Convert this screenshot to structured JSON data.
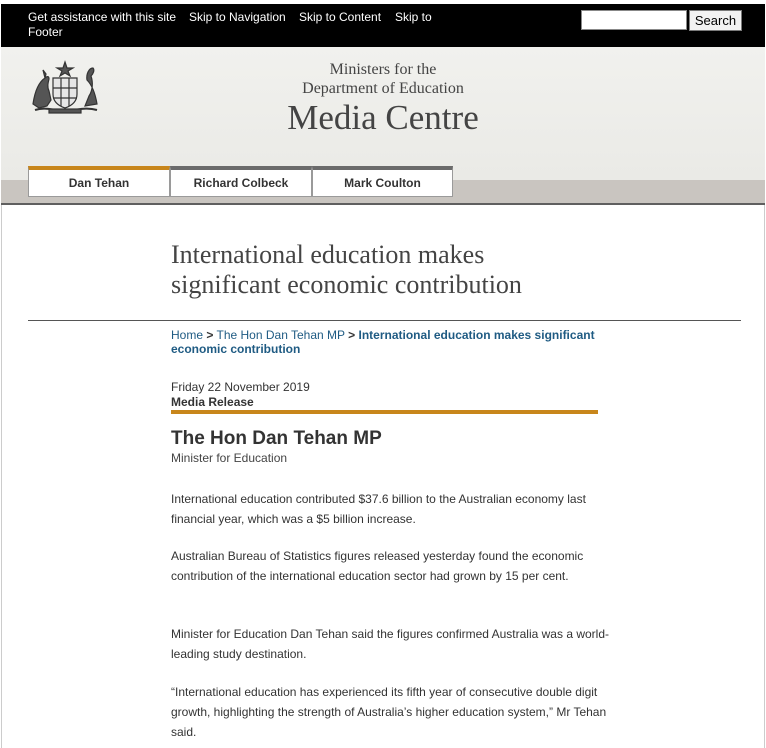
{
  "topbar": {
    "skip_assistance": "Get assistance with this site",
    "skip_navigation": "Skip to Navigation",
    "skip_content": "Skip to Content",
    "skip_footer_line1": "Skip to",
    "skip_footer_line2": "Footer",
    "search_placeholder": "",
    "search_button": "Search"
  },
  "header": {
    "ministers_line1": "Ministers for the",
    "ministers_line2": "Department of Education",
    "site_title": "Media Centre",
    "crest_icon": "coat-of-arms-icon"
  },
  "tabs": [
    {
      "label": "Dan Tehan",
      "active": true
    },
    {
      "label": "Richard Colbeck",
      "active": false
    },
    {
      "label": "Mark Coulton",
      "active": false
    }
  ],
  "article": {
    "title_line1": "International education makes",
    "title_line2": "significant economic contribution",
    "breadcrumb": {
      "home": "Home",
      "sep": ">",
      "minister": "The Hon Dan Tehan MP",
      "current": "International education makes significant economic contribution"
    },
    "date": "Friday 22 November 2019",
    "release_type": "Media Release",
    "minister_name": "The Hon Dan Tehan MP",
    "minister_role": "Minister for Education",
    "paragraphs": [
      "International education contributed $37.6 billion to the Australian economy last financial year, which was a $5 billion increase.",
      "Australian Bureau of Statistics figures released yesterday found the economic contribution of the international education sector had grown by 15 per cent.",
      "Minister for Education Dan Tehan said the figures confirmed Australia was a world-leading study destination.",
      "“International education has experienced its fifth year of consecutive double digit growth, highlighting the strength of Australia’s higher education system,” Mr Tehan said."
    ]
  },
  "colors": {
    "accent_gold": "#c8861b",
    "link_blue": "#1f5b83",
    "topbar_black": "#000000"
  }
}
